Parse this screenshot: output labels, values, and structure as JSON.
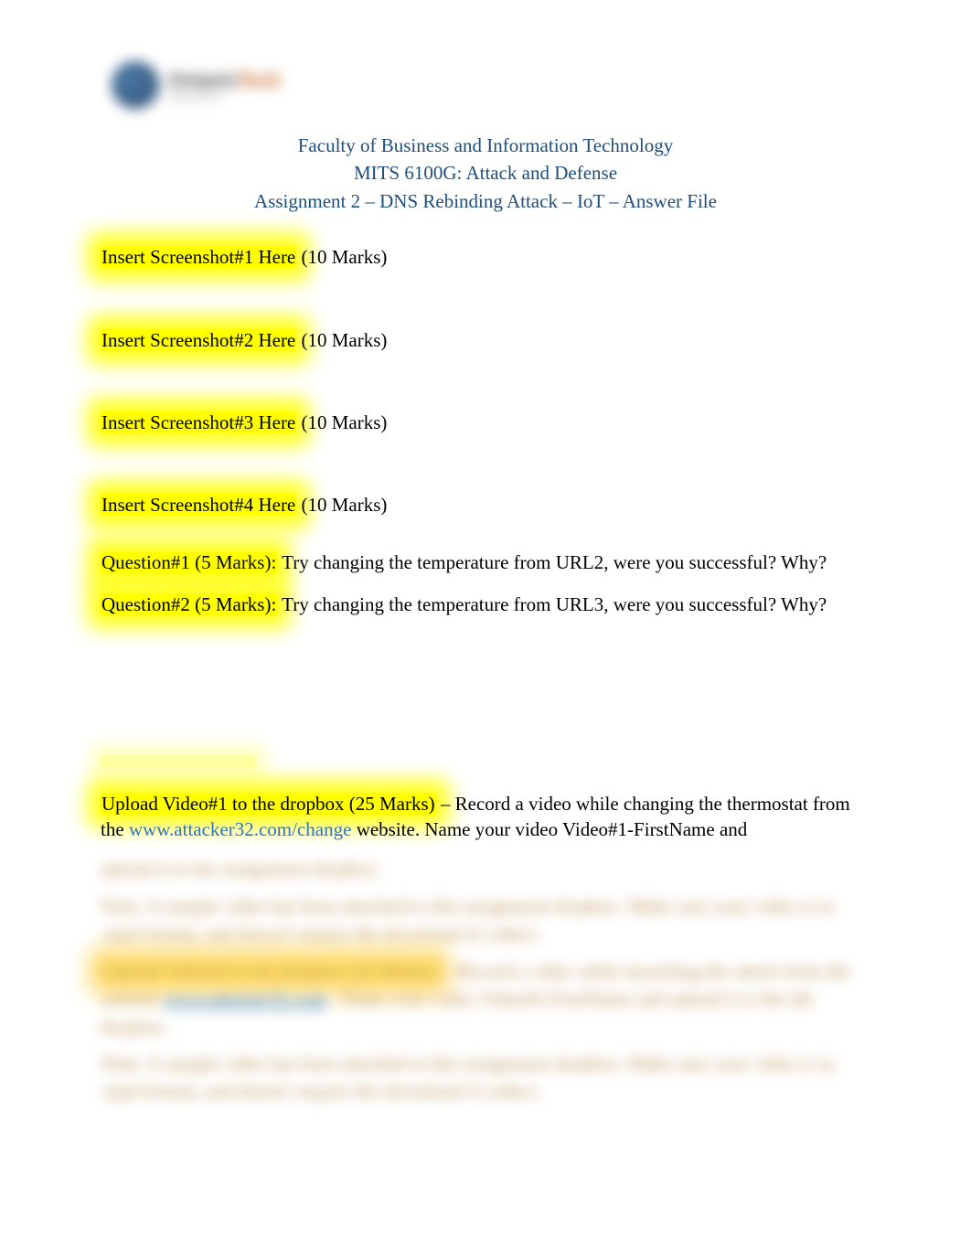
{
  "logo": {
    "name_part1": "Ontario",
    "name_part2": "Tech",
    "tagline": "UNIVERSITY"
  },
  "header": {
    "line1": "Faculty of Business and Information Technology",
    "line2": "MITS 6100G: Attack and Defense",
    "line3": "Assignment 2 – DNS Rebinding Attack – IoT – Answer File"
  },
  "screenshots": [
    {
      "label": "Insert Screenshot#1 Here",
      "marks": " (10 Marks)"
    },
    {
      "label": "Insert Screenshot#2 Here",
      "marks": " (10 Marks)"
    },
    {
      "label": "Insert Screenshot#3 Here",
      "marks": " (10 Marks)"
    },
    {
      "label": "Insert Screenshot#4 Here",
      "marks": " (10 Marks)"
    }
  ],
  "questions": [
    {
      "label": "Question#1 (5 Marks):",
      "text": " Try changing the temperature from URL2, were you successful? Why?"
    },
    {
      "label": "Question#2 (5 Marks):",
      "text": " Try changing the temperature from URL3, were you successful? Why?"
    }
  ],
  "upload1": {
    "label": "Upload Video#1 to the dropbox (25 Marks)",
    "pre": " – Record a video while changing the thermostat from the ",
    "link_text": "www.attacker32.com/change",
    "link_href": "http://www.attacker32.com/change",
    "post": "   website. Name your video Video#1-FirstName and "
  },
  "blurred": {
    "b1": "upload it to the assignment dropbox.",
    "b2": "Note: A sample video has been attached to this assignment dropbox. Make sure your video is in .mp4 format, and doesn't require the download of codecs.",
    "b3_label": "Upload Video#2 to the dropbox (25 Marks)",
    "b3_pre": " – Record a video while launching the attack from the website ",
    "b3_link": "www.attacker32.com",
    "b3_post": " . Name your video Video#2-FirstName and upload it to the lab dropbox.",
    "b4": "Note: A sample video has been attached to this assignment dropbox. Make sure your video is in .mp4 format, and doesn't require the download of codecs."
  }
}
